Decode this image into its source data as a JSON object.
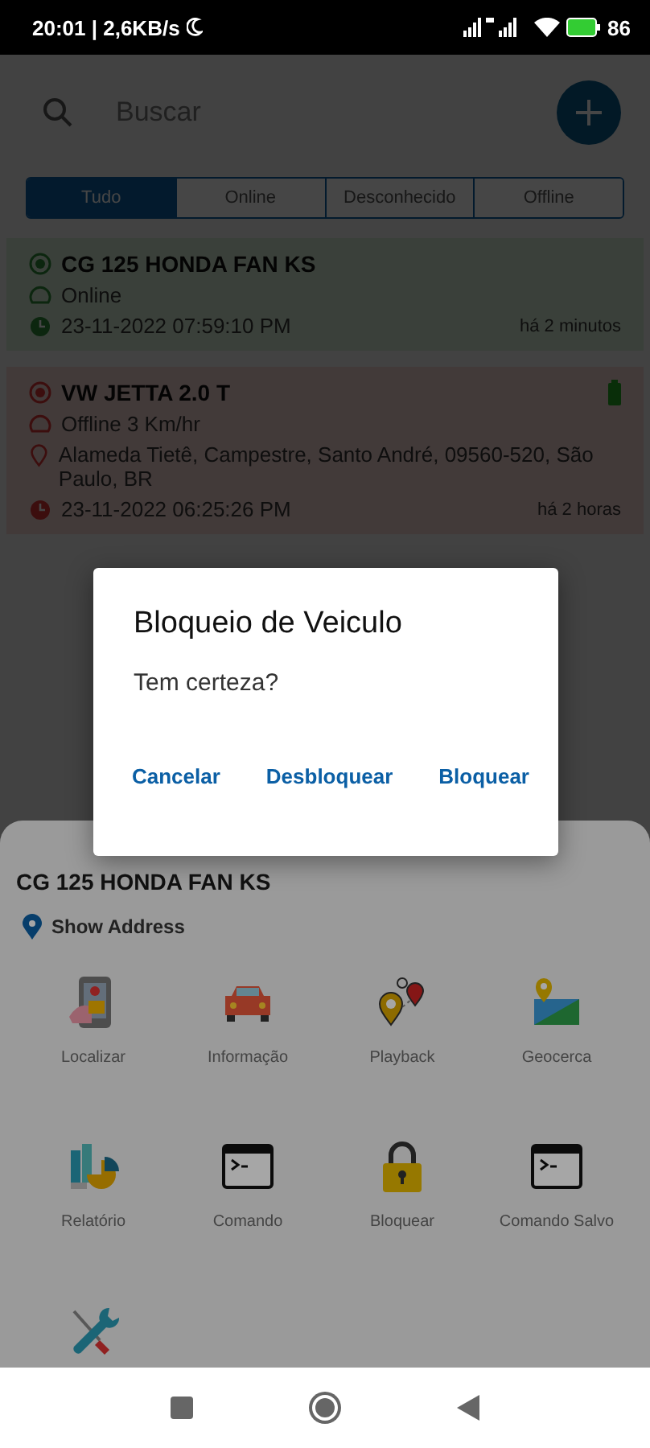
{
  "status_bar": {
    "time_speed": "20:01 | 2,6KB/s",
    "battery": "86"
  },
  "search": {
    "placeholder": "Buscar"
  },
  "tabs": [
    {
      "label": "Tudo",
      "selected": true
    },
    {
      "label": "Online",
      "selected": false
    },
    {
      "label": "Desconhecido",
      "selected": false
    },
    {
      "label": "Offline",
      "selected": false
    }
  ],
  "vehicles": [
    {
      "kind": "online",
      "name": "CG 125 HONDA FAN KS",
      "state": "Online",
      "time": "23-11-2022 07:59:10 PM",
      "ago": "há 2 minutos"
    },
    {
      "kind": "offline",
      "name": "VW JETTA 2.0 T",
      "state": "Offline 3 Km/hr",
      "address": "Alameda Tietê, Campestre, Santo André, 09560-520, São Paulo, BR",
      "time": "23-11-2022 06:25:26 PM",
      "ago": "há 2 horas"
    }
  ],
  "sheet": {
    "title": "CG 125 HONDA FAN KS",
    "show_address": "Show Address",
    "actions": [
      {
        "kind": "phone",
        "label": "Localizar"
      },
      {
        "kind": "car",
        "label": "Informação"
      },
      {
        "kind": "route",
        "label": "Playback"
      },
      {
        "kind": "map",
        "label": "Geocerca"
      },
      {
        "kind": "report",
        "label": "Relatório"
      },
      {
        "kind": "terminal",
        "label": "Comando"
      },
      {
        "kind": "lock",
        "label": "Bloquear"
      },
      {
        "kind": "terminal",
        "label": "Comando Salvo"
      },
      {
        "kind": "tools"
      }
    ]
  },
  "dialog": {
    "title": "Bloqueio de Veiculo",
    "message": "Tem certeza?",
    "buttons": [
      "Cancelar",
      "Desbloquear",
      "Bloquear"
    ]
  }
}
